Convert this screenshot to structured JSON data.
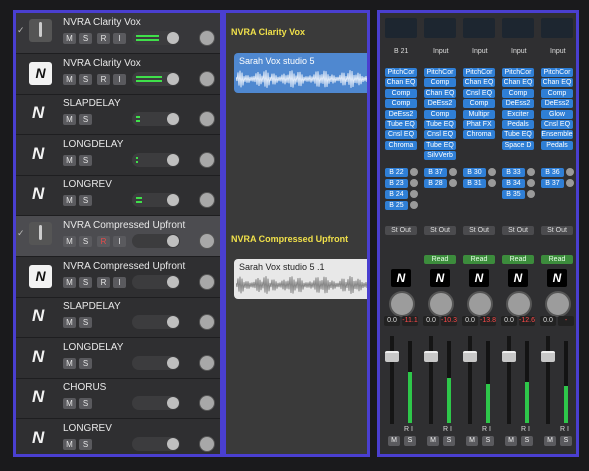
{
  "tracks": [
    {
      "name": "NVRA Clarity Vox",
      "icon": "mic",
      "check": true,
      "rec": true,
      "input": true,
      "meter": 0.75,
      "header": true
    },
    {
      "name": "NVRA Clarity Vox",
      "icon": "nlogo",
      "rec": true,
      "input": true,
      "meter": 0.85
    },
    {
      "name": "SLAPDELAY",
      "icon": "n",
      "meter": 0.12
    },
    {
      "name": "LONGDELAY",
      "icon": "n",
      "meter": 0.08
    },
    {
      "name": "LONGREV",
      "icon": "n",
      "meter": 0.2
    },
    {
      "name": "NVRA Compressed Upfront",
      "icon": "mic",
      "check": true,
      "rec": true,
      "recArmed": true,
      "input": true,
      "meter": 0.0,
      "selected": true
    },
    {
      "name": "NVRA Compressed Upfront",
      "icon": "nlogo",
      "rec": true,
      "input": true,
      "meter": 0.0
    },
    {
      "name": "SLAPDELAY",
      "icon": "n",
      "meter": 0.0
    },
    {
      "name": "LONGDELAY",
      "icon": "n",
      "meter": 0.0
    },
    {
      "name": "CHORUS",
      "icon": "n",
      "meter": 0.0
    },
    {
      "name": "LONGREV",
      "icon": "n",
      "meter": 0.0
    }
  ],
  "buttons": {
    "mute": "M",
    "solo": "S",
    "rec": "R",
    "input": "I"
  },
  "arrange": {
    "label1": "NVRA Clarity Vox",
    "region1": "Sarah Vox studio 5",
    "label2": "NVRA Compressed Upfront",
    "region2": "Sarah Vox studio 5 .1"
  },
  "mixer": {
    "strips": [
      {
        "input": "B 21",
        "plugins": [
          "PitchCor",
          "Chan EQ",
          "Comp",
          "Comp",
          "DeEss2",
          "Tube EQ",
          "Cnsl EQ",
          "Chroma"
        ],
        "sends": [
          "B 22",
          "B 23",
          "B 24",
          "B 25"
        ],
        "output": "St Out",
        "group": "",
        "vol": "0.0",
        "peak": "-11.1",
        "level": 0.62
      },
      {
        "input": "Input",
        "plugins": [
          "PitchCor",
          "Comp",
          "Chan EQ",
          "DeEss2",
          "Comp",
          "Tube EQ",
          "Cnsl EQ",
          "Tube EQ",
          "SilvVerb"
        ],
        "sends": [
          "B 37",
          "B 28"
        ],
        "output": "St Out",
        "group": "Read",
        "vol": "0.0",
        "peak": "-10.3",
        "level": 0.55
      },
      {
        "input": "Input",
        "plugins": [
          "PitchCor",
          "Chan EQ",
          "Cnsl EQ",
          "Comp",
          "Multipr",
          "Phat FX",
          "Chroma"
        ],
        "sends": [
          "B 30",
          "B 31"
        ],
        "output": "St Out",
        "group": "Read",
        "vol": "0.0",
        "peak": "-13.8",
        "level": 0.48
      },
      {
        "input": "Input",
        "plugins": [
          "PitchCor",
          "Chan EQ",
          "Comp",
          "DeEss2",
          "Exciter",
          "Pedals",
          "Tube EQ",
          "Space D"
        ],
        "sends": [
          "B 33",
          "B 34",
          "B 35"
        ],
        "output": "St Out",
        "group": "Read",
        "vol": "0.0",
        "peak": "-12.6",
        "level": 0.5
      },
      {
        "input": "Input",
        "plugins": [
          "PitchCor",
          "Chan EQ",
          "Comp",
          "DeEss2",
          "Glow",
          "Cnsl EQ",
          "Ensemble",
          "Pedals"
        ],
        "sends": [
          "B 36",
          "B 37"
        ],
        "output": "St Out",
        "group": "Read",
        "vol": "0.0",
        "peak": "-",
        "level": 0.45
      }
    ]
  },
  "colors": {
    "accent": "#4a3fd0",
    "plugin": "#2f7fd6",
    "meter": "#3fe04a",
    "region_blue": "#4f88d0",
    "label": "#f0e04a",
    "rec": "#e84a4a"
  }
}
